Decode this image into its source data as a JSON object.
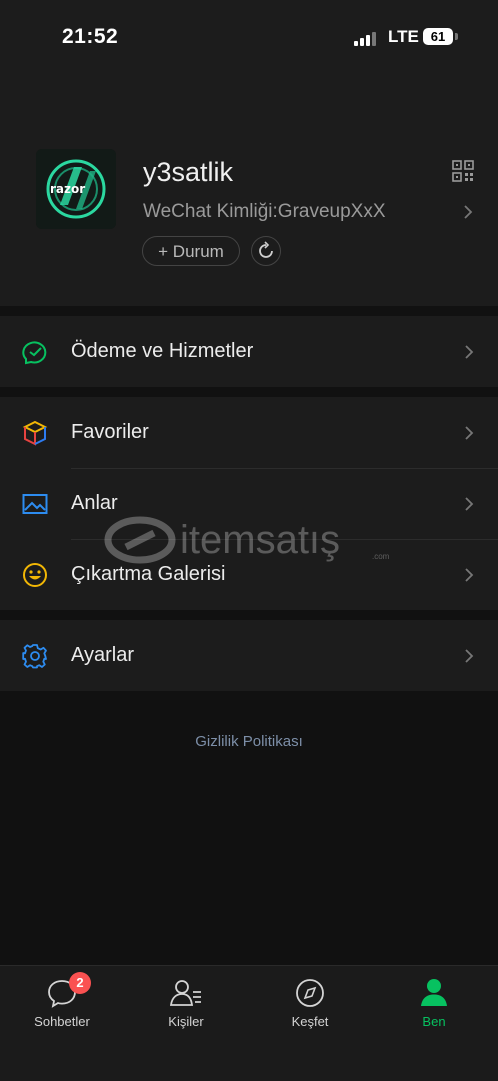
{
  "status_bar": {
    "time": "21:52",
    "network": "LTE",
    "battery": "61"
  },
  "profile": {
    "avatar_text": "razor",
    "name": "y3satlik",
    "wechat_id": "WeChat Kimliği:GraveupXxX",
    "status_button": "+ Durum"
  },
  "menu": {
    "payment": "Ödeme ve Hizmetler",
    "favorites": "Favoriler",
    "moments": "Anlar",
    "stickers": "Çıkartma Galerisi",
    "settings": "Ayarlar"
  },
  "privacy_link": "Gizlilik Politikası",
  "watermark": {
    "text": "itemsatış",
    "suffix": ".com"
  },
  "tabbar": {
    "chats": {
      "label": "Sohbetler",
      "badge": "2"
    },
    "contacts": {
      "label": "Kişiler"
    },
    "discover": {
      "label": "Keşfet"
    },
    "me": {
      "label": "Ben"
    }
  },
  "colors": {
    "accent": "#07c160",
    "badge": "#fa5151",
    "link": "#7d8fa8"
  }
}
